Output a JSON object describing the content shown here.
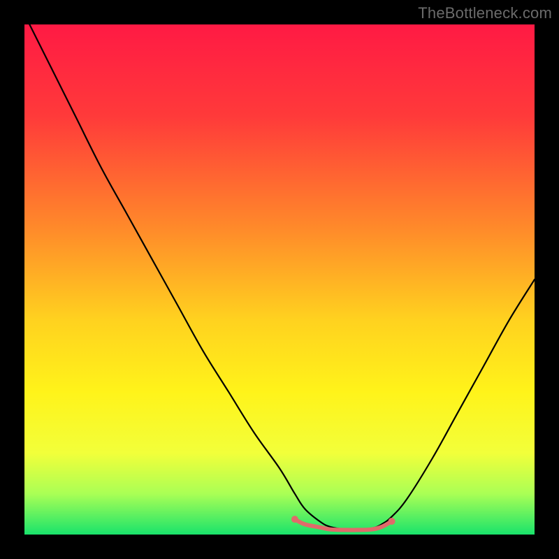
{
  "watermark": "TheBottleneck.com",
  "chart_data": {
    "type": "line",
    "title": "",
    "xlabel": "",
    "ylabel": "",
    "xlim": [
      0,
      100
    ],
    "ylim": [
      0,
      100
    ],
    "gradient_stops": [
      {
        "offset": 0,
        "color": "#ff1a44"
      },
      {
        "offset": 18,
        "color": "#ff3a3a"
      },
      {
        "offset": 40,
        "color": "#ff8a2a"
      },
      {
        "offset": 58,
        "color": "#ffd21f"
      },
      {
        "offset": 72,
        "color": "#fff31a"
      },
      {
        "offset": 84,
        "color": "#f2ff3a"
      },
      {
        "offset": 92,
        "color": "#aaff55"
      },
      {
        "offset": 100,
        "color": "#19e36b"
      }
    ],
    "series": [
      {
        "name": "bottleneck-curve",
        "color": "#000000",
        "width": 2.2,
        "x": [
          1,
          5,
          10,
          15,
          20,
          25,
          30,
          35,
          40,
          45,
          50,
          53,
          55,
          58,
          60,
          63,
          65,
          68,
          70,
          72,
          75,
          80,
          85,
          90,
          95,
          100
        ],
        "y": [
          100,
          92,
          82,
          72,
          63,
          54,
          45,
          36,
          28,
          20,
          13,
          8,
          5,
          2.5,
          1.5,
          1.0,
          1.0,
          1.2,
          2.0,
          3.5,
          7,
          15,
          24,
          33,
          42,
          50
        ]
      },
      {
        "name": "flat-highlight",
        "color": "#e06a6a",
        "width": 6,
        "x": [
          53,
          55,
          58,
          60,
          63,
          65,
          68,
          70,
          72
        ],
        "y": [
          3.0,
          2.0,
          1.4,
          1.0,
          0.9,
          0.9,
          1.0,
          1.5,
          2.6
        ]
      }
    ],
    "dots": {
      "color": "#e06a6a",
      "radius": 5,
      "points": [
        {
          "x": 53,
          "y": 3.0
        },
        {
          "x": 72,
          "y": 2.6
        }
      ]
    }
  }
}
